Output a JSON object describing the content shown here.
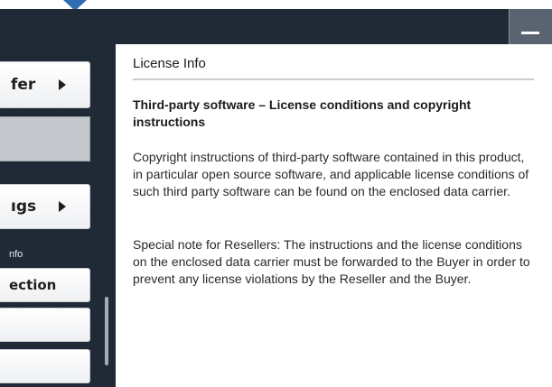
{
  "sidebar": {
    "items": [
      {
        "label": "fer",
        "has_arrow": true
      },
      {
        "label": "",
        "state": "selected"
      },
      {
        "label": "ıgs",
        "has_arrow": true
      }
    ],
    "group_label": "nfo",
    "subitems": [
      {
        "label": "ection"
      },
      {
        "label": ""
      },
      {
        "label": ""
      }
    ]
  },
  "header": {
    "minimize_icon": "minimize-icon"
  },
  "content": {
    "title": "License Info",
    "subtitle": "Third-party software – License conditions and copyright instructions",
    "paragraphs": [
      "Copyright instructions of third-party software contained  in this product, in particular open source software, and applicable license conditions of such third party software can be found on the enclosed data carrier.",
      "Special note for Resellers: The instructions and the license conditions on the enclosed data carrier must be forwarded to the Buyer in order to prevent any license violations by the Reseller and the Buyer."
    ]
  },
  "colors": {
    "header": "#1f2a36",
    "accent": "#2e6db4",
    "button_bg": "#ffffff",
    "selected_bg": "#c4c8cc"
  }
}
